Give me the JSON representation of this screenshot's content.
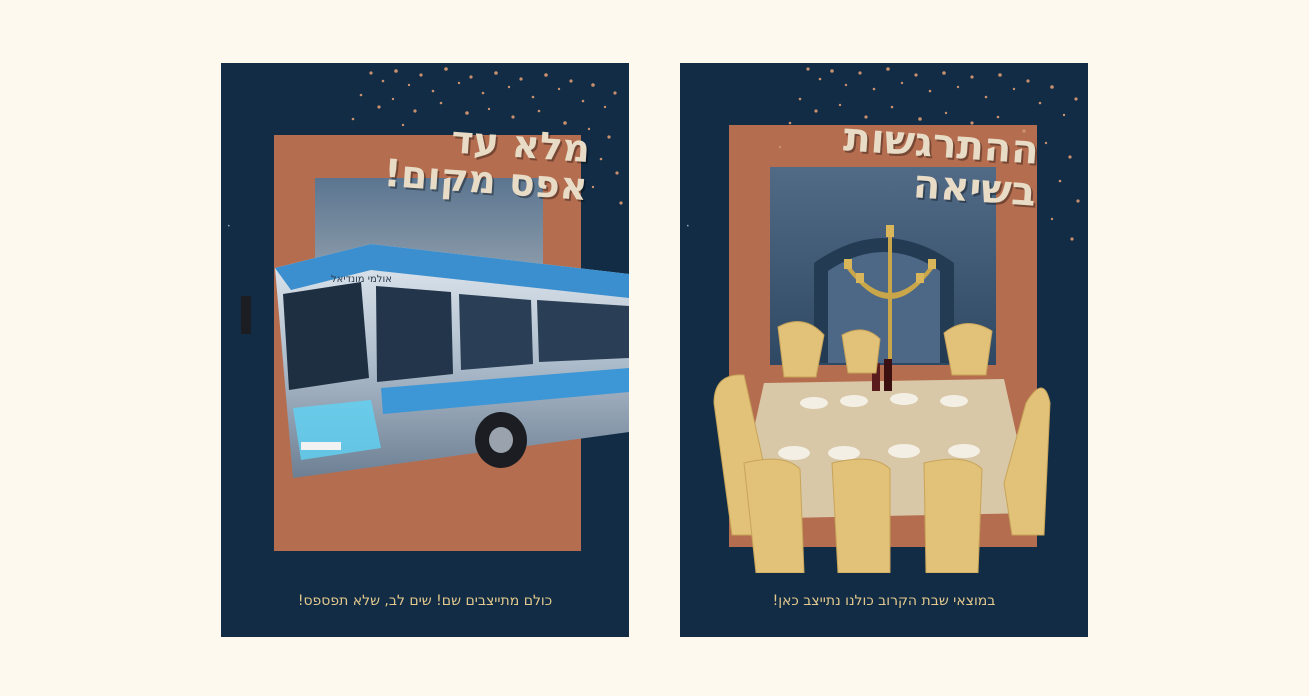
{
  "posters": [
    {
      "headline_line1": "מלא עד",
      "headline_line2": "אפס מקום!",
      "caption": "כולם מתייצבים שם! שים לב, שלא תפספס!",
      "bus_sign": "אולמי מונדיאל",
      "illustration": "bus-icon"
    },
    {
      "headline_line1": "ההתרגשות",
      "headline_line2": "בשיאה",
      "caption": "במוצאי שבת הקרוב כולנו נתייצב כאן!",
      "illustration": "banquet-table-icon"
    }
  ],
  "colors": {
    "page_bg": "#fdf9ee",
    "poster_bg": "#112c44",
    "frame": "#b56d50",
    "headline": "#e8dcc6",
    "caption": "#e3c98e"
  }
}
